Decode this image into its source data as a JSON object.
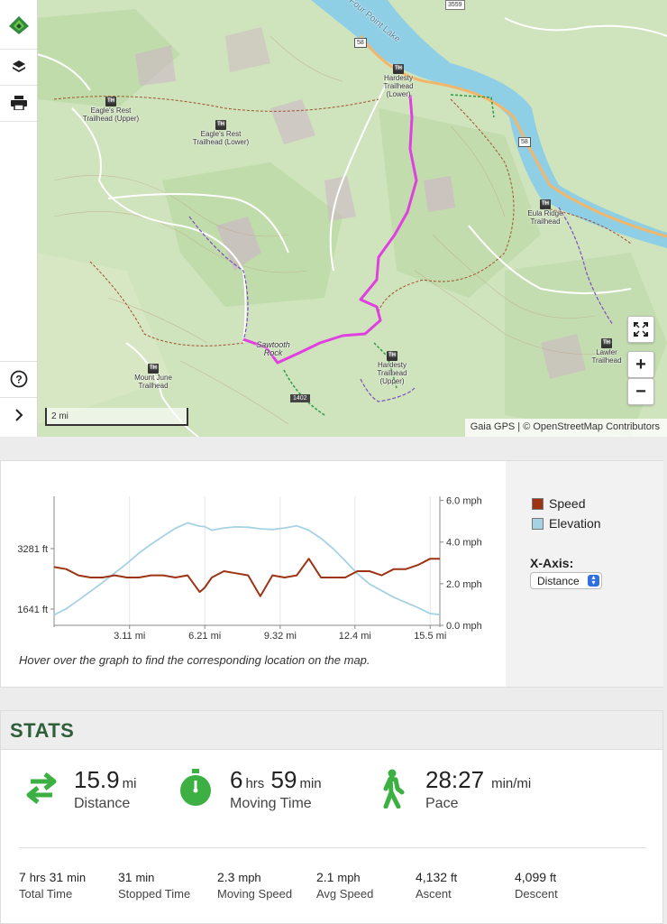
{
  "map": {
    "labels": {
      "four_point_lake": "Four Point Lake",
      "hardesty_lower": "Hardesty Trailhead (Lower)",
      "eagles_rest_upper": "Eagle's Rest Trailhead (Upper)",
      "eagles_rest_lower": "Eagle's Rest Trailhead (Lower)",
      "eula_ridge": "Eula Ridge Trailhead",
      "sawtooth_rock": "Sawtooth Rock",
      "mount_june": "Mount June Trailhead",
      "hardesty_upper": "Hardesty Trailhead (Upper)",
      "lawler": "Lawler Trailhead",
      "road_58a": "58",
      "road_58b": "58",
      "road_1402": "1402",
      "road_3559": "3559",
      "th": "TH"
    },
    "scale_label": "2 mi",
    "attribution": "Gaia GPS | © OpenStreetMap Contributors",
    "controls": {
      "zoom_in": "+",
      "zoom_out": "−"
    },
    "colors": {
      "track": "#e040e0",
      "lake": "#8ecfe6",
      "forest": "#c4deaf",
      "road": "#f2b66a"
    }
  },
  "toolbar": {
    "icons": [
      "gaia-logo-icon",
      "layers-icon",
      "print-icon",
      "help-icon",
      "chevron-right-icon"
    ]
  },
  "graph": {
    "hint": "Hover over the graph to find the corresponding location on the map.",
    "legend": {
      "speed": "Speed",
      "elevation": "Elevation"
    },
    "xaxis_label": "X-Axis:",
    "xaxis_value": "Distance",
    "colors": {
      "speed": "#9c3414",
      "elevation": "#a6d2e4"
    }
  },
  "chart_data": {
    "type": "line",
    "x": [
      0,
      0.5,
      1,
      1.5,
      2,
      2.5,
      3,
      3.5,
      4,
      4.5,
      5,
      5.5,
      6,
      6.2,
      6.5,
      7,
      7.5,
      8,
      8.5,
      9,
      9.5,
      10,
      10.5,
      11,
      11.5,
      12,
      12.5,
      13,
      13.5,
      14,
      14.5,
      15,
      15.5,
      15.9
    ],
    "series": [
      {
        "name": "Elevation",
        "axis": "left",
        "values": [
          1480,
          1650,
          1880,
          2120,
          2360,
          2620,
          2880,
          3160,
          3400,
          3620,
          3830,
          3980,
          3890,
          3880,
          3780,
          3840,
          3870,
          3860,
          3820,
          3800,
          3840,
          3900,
          3780,
          3560,
          3280,
          2950,
          2600,
          2320,
          2140,
          1960,
          1820,
          1680,
          1520,
          1490
        ]
      },
      {
        "name": "Speed",
        "axis": "right",
        "values": [
          2.8,
          2.7,
          2.4,
          2.3,
          2.3,
          2.4,
          2.3,
          2.3,
          2.4,
          2.4,
          2.3,
          2.4,
          1.6,
          1.8,
          2.3,
          2.6,
          2.5,
          2.4,
          1.4,
          2.4,
          2.3,
          2.4,
          3.2,
          2.3,
          2.3,
          2.3,
          2.6,
          2.6,
          2.4,
          2.7,
          2.7,
          2.9,
          3.2,
          3.2
        ]
      }
    ],
    "x_ticks": [
      "3.11 mi",
      "6.21 mi",
      "9.32 mi",
      "12.4 mi",
      "15.5 mi"
    ],
    "x_tick_values": [
      3.11,
      6.21,
      9.32,
      12.4,
      15.5
    ],
    "y_left_ticks": [
      "3281 ft",
      "1641 ft"
    ],
    "y_left_tick_values": [
      3281,
      1641
    ],
    "y_right_ticks": [
      "6.0 mph",
      "4.0 mph",
      "2.0 mph",
      "0.0 mph"
    ],
    "y_right_tick_values": [
      6,
      4,
      2,
      0
    ],
    "xlim": [
      0,
      15.9
    ],
    "ylim_left": [
      1200,
      4700
    ],
    "ylim_right": [
      0,
      6.2
    ],
    "legend_position": "right",
    "grid": "vertical"
  },
  "stats": {
    "title": "STATS",
    "distance": {
      "value": "15.9",
      "unit": "mi",
      "label": "Distance"
    },
    "moving_time": {
      "hrs": "6",
      "hrs_unit": "hrs",
      "min": "59",
      "min_unit": "min",
      "label": "Moving Time"
    },
    "pace": {
      "value": "28:27",
      "unit": "min/mi",
      "label": "Pace"
    },
    "total_time": {
      "hrs": "7",
      "hrs_unit": "hrs",
      "min": "31",
      "min_unit": "min",
      "label": "Total Time"
    },
    "stopped_time": {
      "value": "31",
      "unit": "min",
      "label": "Stopped Time"
    },
    "moving_speed": {
      "value": "2.3",
      "unit": "mph",
      "label": "Moving Speed"
    },
    "avg_speed": {
      "value": "2.1",
      "unit": "mph",
      "label": "Avg Speed"
    },
    "ascent": {
      "value": "4,132",
      "unit": "ft",
      "label": "Ascent"
    },
    "descent": {
      "value": "4,099",
      "unit": "ft",
      "label": "Descent"
    },
    "icon_color": "#3cb043"
  }
}
